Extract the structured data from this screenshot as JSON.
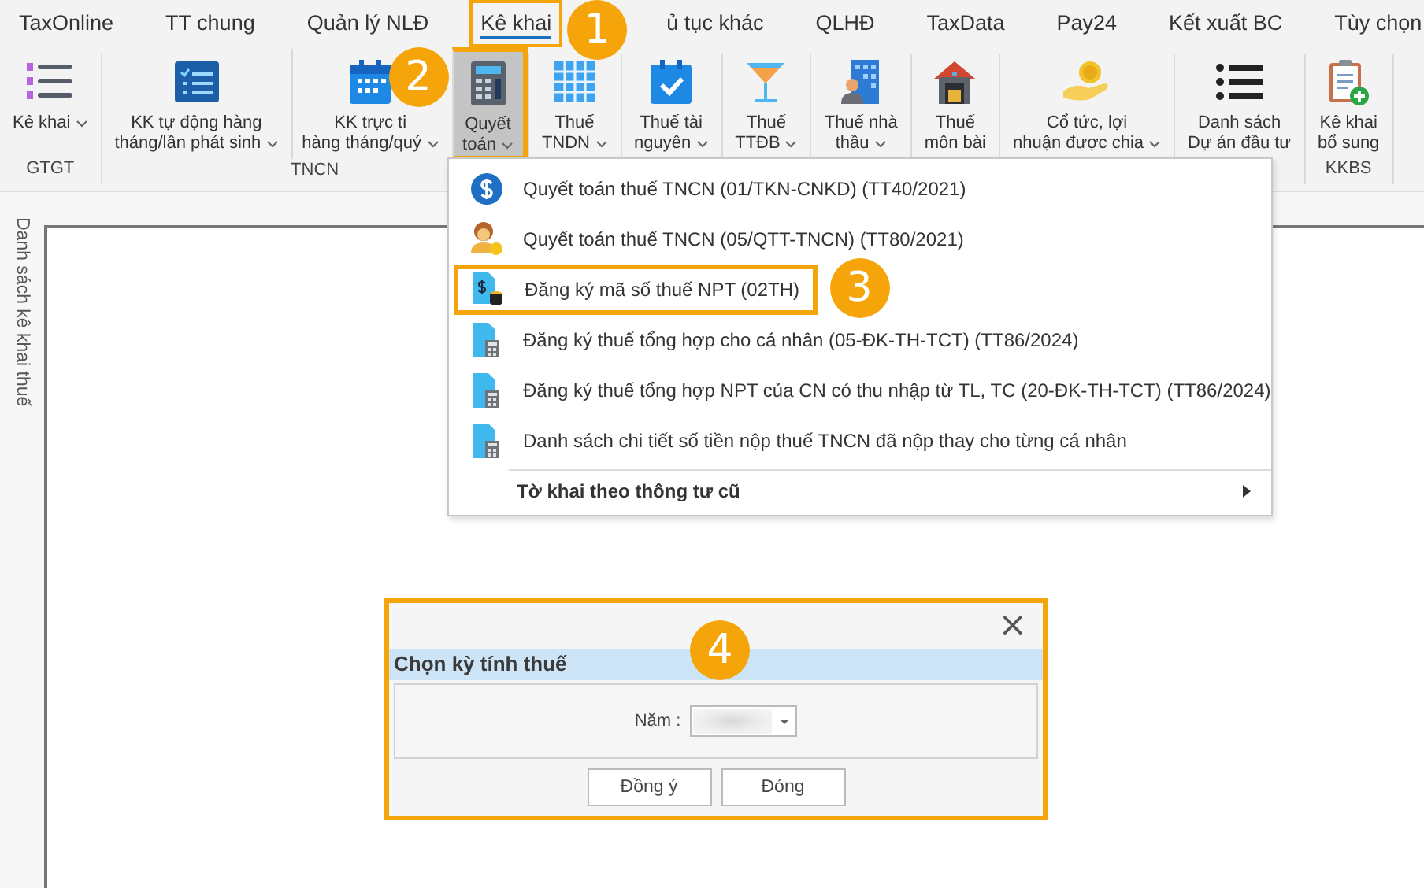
{
  "tabs": [
    {
      "label": "TaxOnline",
      "selected": false,
      "highlighted": false
    },
    {
      "label": "TT chung",
      "selected": false,
      "highlighted": false
    },
    {
      "label": "Quản lý NLĐ",
      "selected": false,
      "highlighted": false
    },
    {
      "label": "Kê khai",
      "selected": true,
      "highlighted": true,
      "callout": "1"
    },
    {
      "label": "ủ tục khác",
      "selected": false,
      "highlighted": false
    },
    {
      "label": "QLHĐ",
      "selected": false,
      "highlighted": false
    },
    {
      "label": "TaxData",
      "selected": false,
      "highlighted": false
    },
    {
      "label": "Pay24",
      "selected": false,
      "highlighted": false
    },
    {
      "label": "Kết xuất BC",
      "selected": false,
      "highlighted": false
    },
    {
      "label": "Tùy chọn",
      "selected": false,
      "highlighted": false
    }
  ],
  "ribbon": {
    "groups": [
      {
        "label": "GTGT",
        "buttons": [
          {
            "label": "Kê khai",
            "dropdown": true,
            "selected": false,
            "highlighted": false
          }
        ]
      },
      {
        "label": "TNCN",
        "buttons": [
          {
            "label": "KK tự động hàng\ntháng/lần phát sinh",
            "dropdown": true,
            "selected": false,
            "highlighted": false
          },
          {
            "label": "KK trực ti\nhàng tháng/quý",
            "dropdown": true,
            "selected": false,
            "highlighted": false
          },
          {
            "label": "Quyết\ntoán",
            "dropdown": true,
            "selected": true,
            "highlighted": true,
            "callout": "2"
          }
        ]
      },
      {
        "buttons": [
          {
            "label": "Thuế\nTNDN",
            "dropdown": true,
            "selected": false,
            "highlighted": false
          }
        ]
      },
      {
        "buttons": [
          {
            "label": "Thuế tài\nnguyên",
            "dropdown": true,
            "selected": false,
            "highlighted": false
          }
        ]
      },
      {
        "buttons": [
          {
            "label": "Thuế\nTTĐB",
            "dropdown": true,
            "selected": false,
            "highlighted": false
          }
        ]
      },
      {
        "buttons": [
          {
            "label": "Thuế nhà\nthầu",
            "dropdown": true,
            "selected": false,
            "highlighted": false
          }
        ]
      },
      {
        "buttons": [
          {
            "label": "Thuế\nmôn bài",
            "dropdown": false,
            "selected": false,
            "highlighted": false
          }
        ]
      },
      {
        "buttons": [
          {
            "label": "Cổ tức, lợi\nnhuận được chia",
            "dropdown": true,
            "selected": false,
            "highlighted": false
          }
        ]
      },
      {
        "buttons": [
          {
            "label": "Danh sách\nDự án đầu tư",
            "dropdown": false,
            "selected": false,
            "highlighted": false
          }
        ]
      },
      {
        "label": "KKBS",
        "buttons": [
          {
            "label": "Kê khai\nbổ sung",
            "dropdown": false,
            "selected": false,
            "highlighted": false
          }
        ]
      }
    ]
  },
  "side_tab": {
    "label": "Danh sách kê khai thuế"
  },
  "menu": {
    "items": [
      {
        "kind": "item",
        "label": "Quyết toán thuế TNCN (01/TKN-CNKD) (TT40/2021)",
        "highlighted": false
      },
      {
        "kind": "item",
        "label": "Quyết toán thuế TNCN (05/QTT-TNCN) (TT80/2021)",
        "highlighted": false
      },
      {
        "kind": "item",
        "label": "Đăng ký mã số thuế NPT (02TH)",
        "highlighted": true,
        "callout": "3"
      },
      {
        "kind": "item",
        "label": "Đăng ký thuế tổng hợp cho cá nhân (05-ĐK-TH-TCT) (TT86/2024)",
        "highlighted": false
      },
      {
        "kind": "item",
        "label": "Đăng ký thuế tổng hợp NPT của CN có thu nhập từ TL, TC (20-ĐK-TH-TCT) (TT86/2024)",
        "highlighted": false
      },
      {
        "kind": "item",
        "label": "Danh sách chi tiết số tiền nộp thuế TNCN đã nộp thay cho từng cá nhân",
        "highlighted": false
      },
      {
        "kind": "submenu",
        "label": "Tờ khai theo thông tư cũ",
        "highlighted": false
      }
    ]
  },
  "dialog": {
    "close": "×",
    "title": "Chọn kỳ tính thuế",
    "field_label": "Năm :",
    "buttons": [
      "Đồng ý",
      "Đóng"
    ],
    "highlighted": true,
    "callout": "4"
  }
}
